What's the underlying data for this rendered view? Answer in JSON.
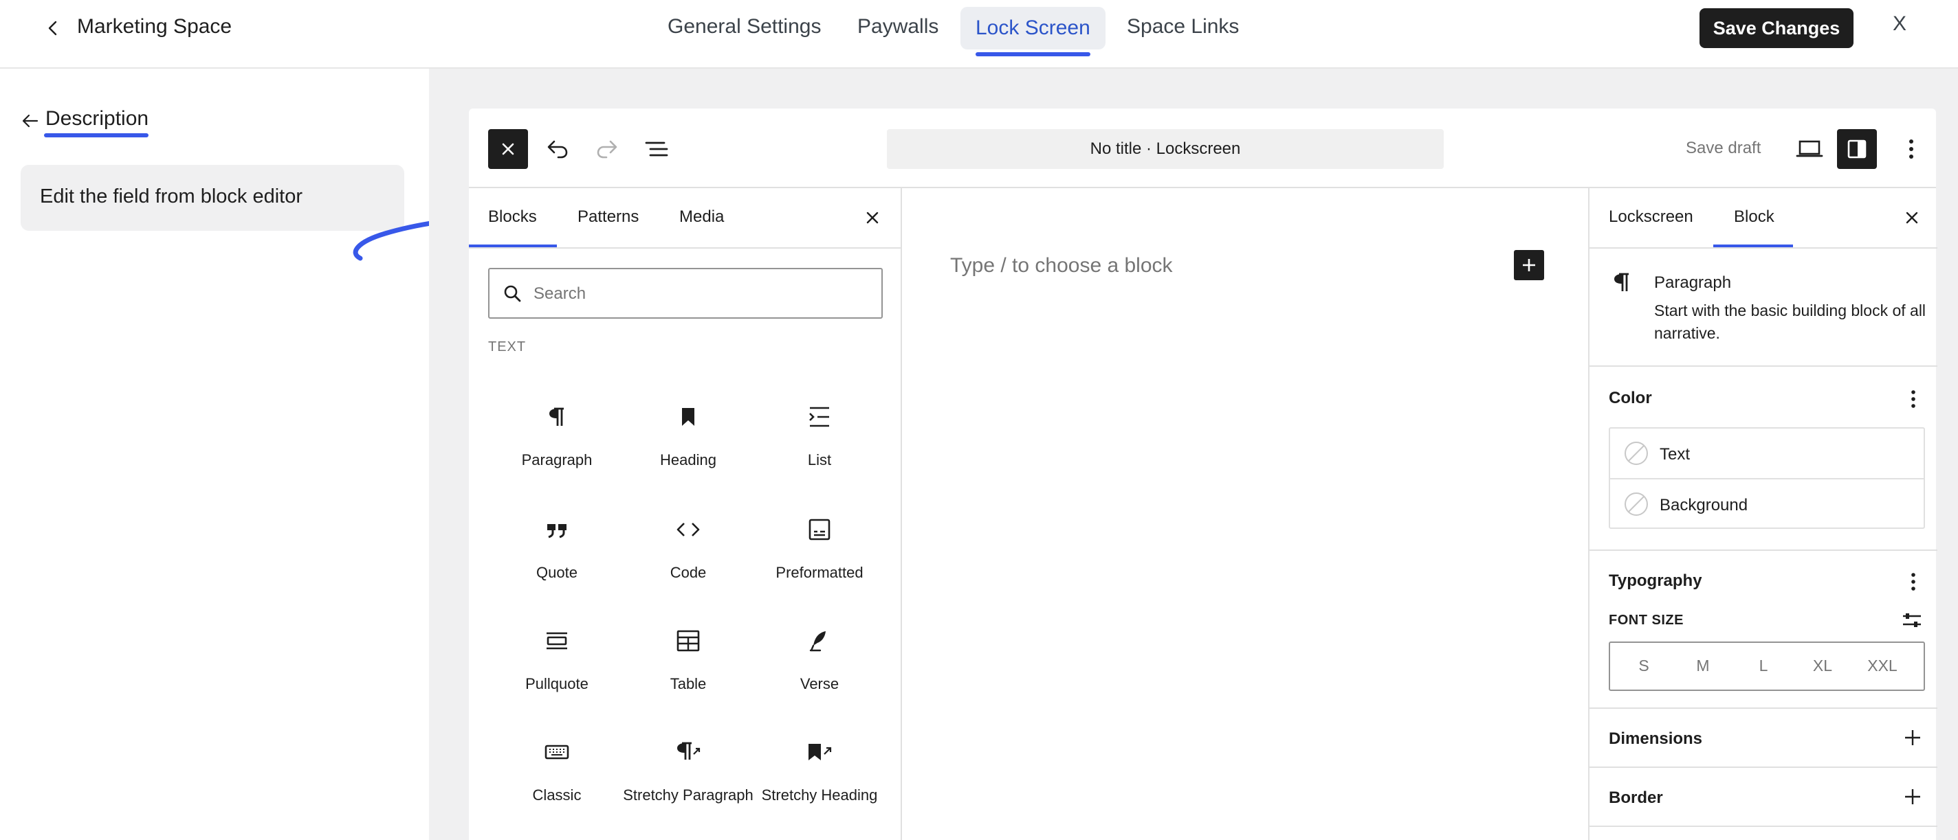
{
  "header": {
    "space_name": "Marketing Space",
    "tabs": [
      {
        "label": "General Settings"
      },
      {
        "label": "Paywalls"
      },
      {
        "label": "Lock Screen",
        "active": true
      },
      {
        "label": "Space Links"
      }
    ],
    "save_label": "Save Changes",
    "close_label": "X"
  },
  "left_panel": {
    "title": "Description",
    "hint": "Edit the field from block editor"
  },
  "editor": {
    "doc_title": "No title · Lockscreen",
    "save_draft": "Save draft",
    "inserter": {
      "tabs": [
        "Blocks",
        "Patterns",
        "Media"
      ],
      "active_tab": "Blocks",
      "search_placeholder": "Search",
      "category": "TEXT",
      "blocks": [
        {
          "label": "Paragraph",
          "icon": "paragraph-icon"
        },
        {
          "label": "Heading",
          "icon": "heading-icon"
        },
        {
          "label": "List",
          "icon": "list-icon"
        },
        {
          "label": "Quote",
          "icon": "quote-icon"
        },
        {
          "label": "Code",
          "icon": "code-icon"
        },
        {
          "label": "Preformatted",
          "icon": "preformatted-icon"
        },
        {
          "label": "Pullquote",
          "icon": "pullquote-icon"
        },
        {
          "label": "Table",
          "icon": "table-icon"
        },
        {
          "label": "Verse",
          "icon": "verse-icon"
        },
        {
          "label": "Classic",
          "icon": "classic-icon"
        },
        {
          "label": "Stretchy Paragraph",
          "icon": "stretchy-paragraph-icon"
        },
        {
          "label": "Stretchy Heading",
          "icon": "stretchy-heading-icon"
        }
      ]
    },
    "canvas": {
      "placeholder": "Type / to choose a block"
    },
    "settings": {
      "tabs": [
        "Lockscreen",
        "Block"
      ],
      "active_tab": "Block",
      "block_name": "Paragraph",
      "block_description": "Start with the basic building block of all narrative.",
      "color": {
        "title": "Color",
        "items": [
          "Text",
          "Background"
        ]
      },
      "typography": {
        "title": "Typography",
        "font_size_label": "FONT SIZE",
        "sizes": [
          "S",
          "M",
          "L",
          "XL",
          "XXL"
        ]
      },
      "dimensions_title": "Dimensions",
      "border_title": "Border"
    }
  },
  "colors": {
    "accent": "#3858e9",
    "active_tab_text": "#2b54c9",
    "dark": "#1e1e1e",
    "canvas_bg": "#f0f0f1"
  }
}
